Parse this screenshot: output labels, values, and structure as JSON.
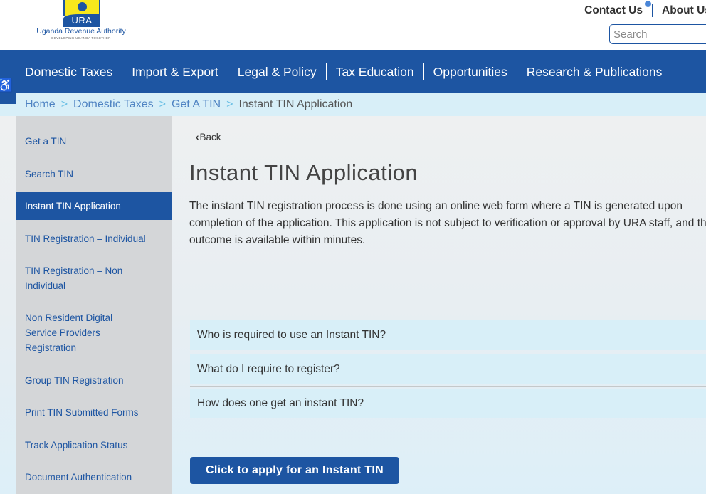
{
  "header": {
    "logo": {
      "abbr": "URA",
      "name": "Uganda Revenue Authority",
      "tagline": "DEVELOPING UGANDA TOGETHER"
    },
    "top_links": {
      "contact": "Contact Us",
      "about": "About Us"
    },
    "search": {
      "placeholder": "Search",
      "value": ""
    }
  },
  "nav": {
    "items": [
      {
        "label": "Domestic Taxes"
      },
      {
        "label": "Import & Export"
      },
      {
        "label": "Legal & Policy"
      },
      {
        "label": "Tax Education"
      },
      {
        "label": "Opportunities"
      },
      {
        "label": "Research & Publications"
      }
    ],
    "accessibility_icon": "♿"
  },
  "breadcrumb": {
    "items": [
      "Home",
      "Domestic Taxes",
      "Get A TIN"
    ],
    "separator": ">",
    "current": "Instant TIN Application"
  },
  "sidebar": {
    "items": [
      {
        "label": "Get a TIN",
        "active": false
      },
      {
        "label": "Search TIN",
        "active": false
      },
      {
        "label": "Instant TIN Application",
        "active": true
      },
      {
        "label": "TIN Registration – Individual",
        "active": false
      },
      {
        "label": "TIN Registration – Non Individual",
        "active": false
      },
      {
        "label": "Non Resident Digital Service Providers Registration",
        "active": false
      },
      {
        "label": "Group TIN Registration",
        "active": false
      },
      {
        "label": "Print TIN Submitted Forms",
        "active": false
      },
      {
        "label": "Track Application Status",
        "active": false
      },
      {
        "label": "Document Authentication",
        "active": false
      }
    ]
  },
  "content": {
    "back_label": "Back",
    "title": "Instant TIN Application",
    "intro": "The instant TIN registration process is done using an online web form where a TIN is generated upon completion of the application. This application is not subject to verification or approval by URA staff, and the outcome is available within minutes.",
    "faqs": [
      {
        "question": "Who is required to use an Instant TIN?"
      },
      {
        "question": "What do I require to register?"
      },
      {
        "question": "How does one get an instant TIN?"
      }
    ],
    "apply_button": "Click to apply for an Instant TIN"
  },
  "colors": {
    "brand_blue": "#1d55a2",
    "breadcrumb_bg": "#d8eff8",
    "sidebar_bg": "#d4d6d8",
    "logo_yellow": "#f7e81c",
    "notification_dot": "#4a86d8"
  }
}
